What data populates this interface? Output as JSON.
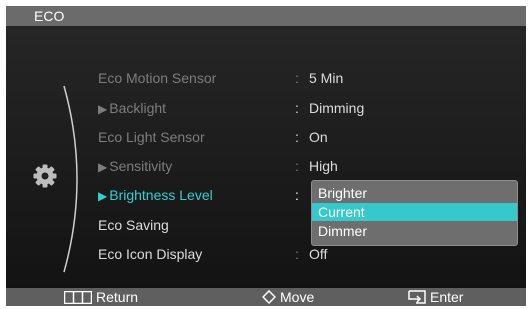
{
  "window": {
    "title": "ECO"
  },
  "menu": {
    "items": [
      {
        "label": "Eco Motion Sensor",
        "value": "5 Min"
      },
      {
        "label": "Backlight",
        "value": "Dimming"
      },
      {
        "label": "Eco Light Sensor",
        "value": "On"
      },
      {
        "label": "Sensitivity",
        "value": "High"
      },
      {
        "label": "Brightness Level",
        "value": ""
      },
      {
        "label": "Eco Saving",
        "value": ""
      },
      {
        "label": "Eco Icon Display",
        "value": "Off"
      }
    ],
    "separator": ":"
  },
  "dropdown": {
    "options": [
      "Brighter",
      "Current",
      "Dimmer"
    ],
    "selected": "Current"
  },
  "footer": {
    "return_label": "Return",
    "move_label": "Move",
    "enter_label": "Enter"
  },
  "colors": {
    "highlight": "#35c9cc",
    "selected_text": "#2fcfd2",
    "titlebar": "#6b6b6b",
    "background": "#1c1c1c"
  },
  "icons": [
    "gear-icon",
    "arrow-right-icon",
    "return-icon",
    "move-icon",
    "enter-icon"
  ]
}
